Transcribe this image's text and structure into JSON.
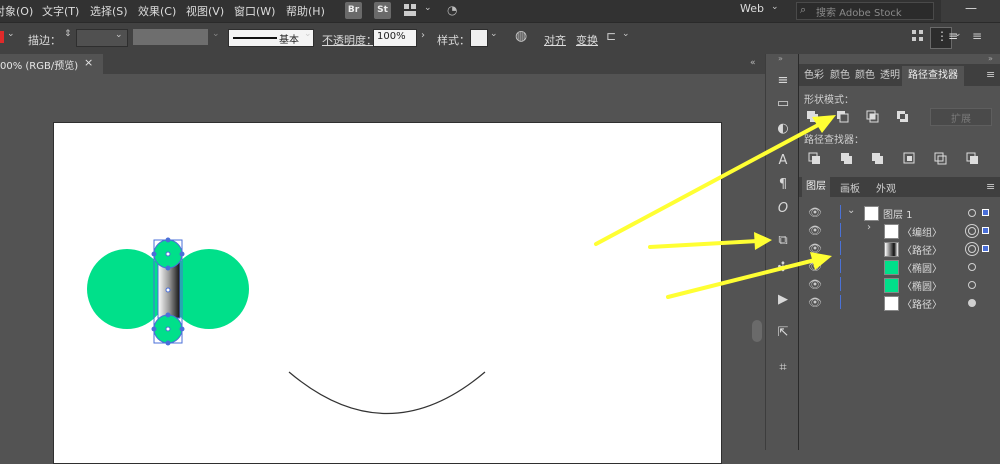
{
  "menu": [
    "对象(O)",
    "文字(T)",
    "选择(S)",
    "效果(C)",
    "视图(V)",
    "窗口(W)",
    "帮助(H)"
  ],
  "app_badges": [
    "Br",
    "St"
  ],
  "workspace": "Web",
  "search_placeholder": "搜索 Adobe Stock",
  "control": {
    "stroke_label": "描边：",
    "basic_label": "基本",
    "opacity_label": "不透明度：",
    "opacity_value": "100%",
    "style_label": "样式：",
    "align_label": "对齐",
    "transform_label": "变换"
  },
  "doc_tab": "00% (RGB/预览)",
  "doc_tab_close": "×",
  "panel_top": {
    "tabs": [
      "色彩",
      "颜色",
      "颜色",
      "透明",
      "路径查找器"
    ],
    "active_tab": "路径查找器",
    "shape_modes_label": "形状模式：",
    "pathfinder_label": "路径查找器：",
    "expand_button": "扩展"
  },
  "panel_layers": {
    "tabs": [
      "图层",
      "画板",
      "外观"
    ],
    "active_tab": "图层",
    "rows": [
      {
        "name": "图层 1",
        "thumb": "group",
        "indent": 0
      },
      {
        "name": "〈编组〉",
        "thumb": "group",
        "indent": 1
      },
      {
        "name": "〈路径〉",
        "thumb": "path",
        "indent": 1
      },
      {
        "name": "〈椭圆〉",
        "thumb": "ellipse",
        "indent": 1
      },
      {
        "name": "〈椭圆〉",
        "thumb": "ellipse",
        "indent": 1
      },
      {
        "name": "〈路径〉",
        "thumb": "arc",
        "indent": 1
      }
    ]
  },
  "colors": {
    "ellipse_fill": "#00e08a",
    "selection_blue": "#4a6fd8",
    "annotation_arrow": "#ffff33"
  }
}
